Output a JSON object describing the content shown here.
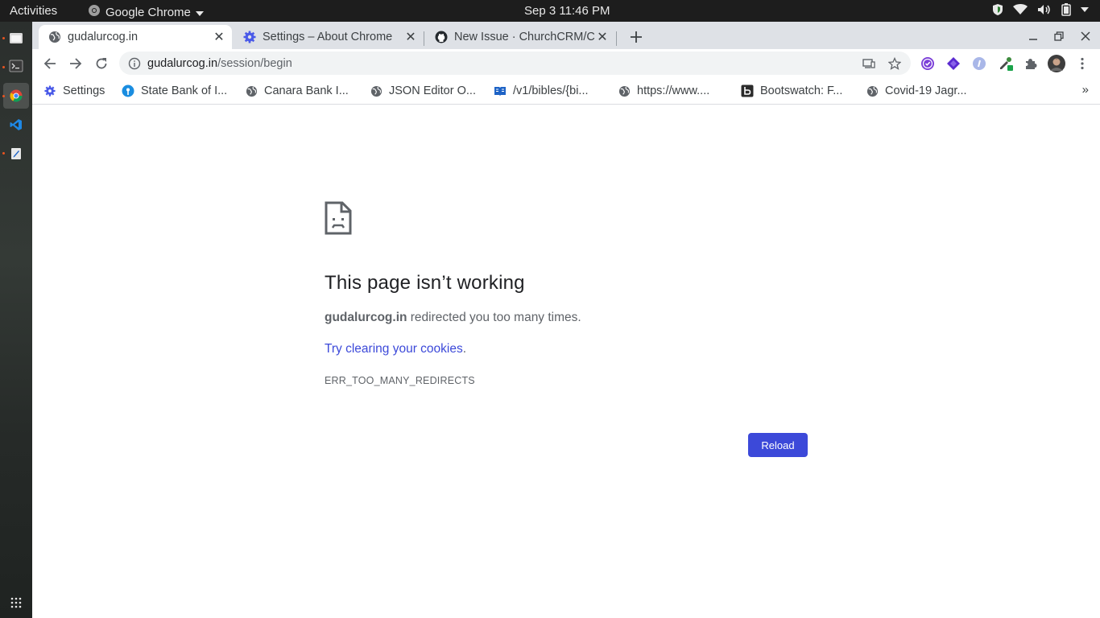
{
  "topbar": {
    "activities": "Activities",
    "app_name": "Google Chrome",
    "clock": "Sep 3  11:46 PM"
  },
  "dock": {
    "items": [
      "files-icon",
      "terminal-icon",
      "chrome-icon",
      "vscode-icon",
      "text-editor-icon"
    ],
    "apps_grid": "show-applications-icon"
  },
  "tabs": [
    {
      "title": "gudalurcog.in",
      "favicon": "globe-icon",
      "active": true
    },
    {
      "title": "Settings – About Chrome",
      "favicon": "settings-gear-icon",
      "active": false
    },
    {
      "title": "New Issue · ChurchCRM/C",
      "favicon": "github-icon",
      "active": false
    }
  ],
  "omnibox": {
    "host": "gudalurcog.in",
    "path": "/session/begin"
  },
  "bookmarks": [
    {
      "label": "Settings",
      "icon": "settings-gear-icon"
    },
    {
      "label": "State Bank of I...",
      "icon": "sbi-icon"
    },
    {
      "label": "Canara Bank I...",
      "icon": "globe-icon"
    },
    {
      "label": "JSON Editor O...",
      "icon": "globe-icon"
    },
    {
      "label": "/v1/bibles/{bi...",
      "icon": "book-icon"
    },
    {
      "label": "https://www....",
      "icon": "globe-icon"
    },
    {
      "label": "Bootswatch: F...",
      "icon": "bootswatch-icon"
    },
    {
      "label": "Covid-19 Jagr...",
      "icon": "globe-icon"
    }
  ],
  "error_page": {
    "heading": "This page isn’t working",
    "host": "gudalurcog.in",
    "description_suffix": " redirected you too many times.",
    "suggestion_link": "Try clearing your cookies",
    "suggestion_suffix": ".",
    "error_code": "ERR_TOO_MANY_REDIRECTS",
    "reload_label": "Reload"
  },
  "colors": {
    "accent": "#3c49d9",
    "topbar_bg": "#1d1d1d",
    "tabstrip_bg": "#dee1e6"
  }
}
